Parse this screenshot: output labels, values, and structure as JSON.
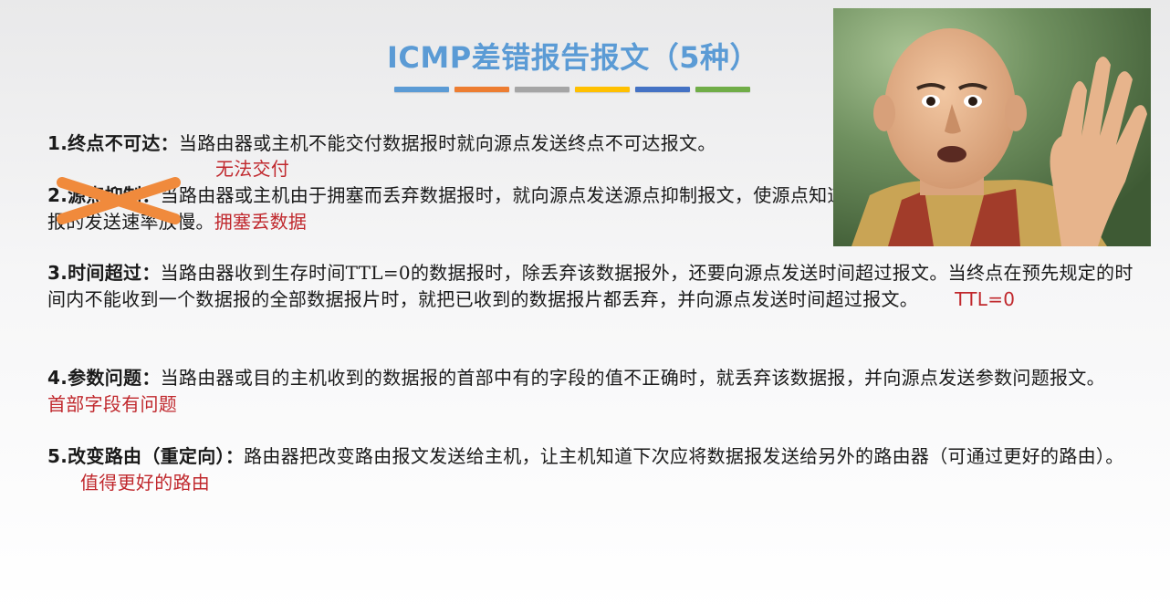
{
  "slide": {
    "title": "ICMP差错报告报文（5种）",
    "underline_colors": [
      "#5b9bd5",
      "#ed7d31",
      "#a5a5a5",
      "#ffc000",
      "#4472c4",
      "#70ad47"
    ]
  },
  "items": [
    {
      "label": "1.终点不可达：",
      "text": "当路由器或主机不能交付数据报时就向源点发送终点不可达报文。",
      "note": "无法交付"
    },
    {
      "label": "2.源点抑制：",
      "text_line1": "当路由器或主机由于拥塞而丢弃数据报时，就向源点发送源点抑制报文，使源点知道应当把数据",
      "text_line2": "报的发送速率放慢。",
      "note": "拥塞丢数据",
      "struck": true
    },
    {
      "label": "3.时间超过：",
      "text": "当路由器收到生存时间TTL=0的数据报时，除丢弃该数据报外，还要向源点发送时间超过报文。当终点在预先规定的时间内不能收到一个数据报的全部数据报片时，就把已收到的数据报片都丢弃，并向源点发送时间超过报文。",
      "note": "TTL=0"
    },
    {
      "label": "4.参数问题：",
      "text": "当路由器或目的主机收到的数据报的首部中有的字段的值不正确时，就丢弃该数据报，并向源点发送参数问题报文。",
      "note": "首部字段有问题"
    },
    {
      "label": "5.改变路由（重定向）：",
      "text": "路由器把改变路由报文发送给主机，让主机知道下次应将数据报发送给另外的路由器（可通过更好的路由）。",
      "note": "值得更好的路由"
    }
  ],
  "photo": {
    "icon": "man-raising-hand-photo",
    "colors": {
      "background": "#6e8f5e",
      "skin": "#e8b48c",
      "robe": "#c9a455"
    }
  },
  "cross_mark": {
    "icon": "orange-x-icon",
    "color": "#f08a3c"
  }
}
